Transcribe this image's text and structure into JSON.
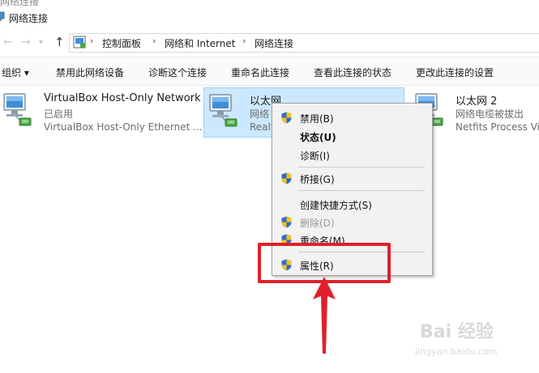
{
  "window": {
    "title": "网络连接",
    "cut_text": "网络连接"
  },
  "nav": {
    "back_icon": "back-arrow-icon",
    "forward_icon": "forward-arrow-icon",
    "up_icon": "up-arrow-icon"
  },
  "breadcrumb": [
    "控制面板",
    "网络和 Internet",
    "网络连接"
  ],
  "toolbar": {
    "organize": "组织 ▾",
    "disable": "禁用此网络设备",
    "diagnose": "诊断这个连接",
    "rename": "重命名此连接",
    "status": "查看此连接的状态",
    "settings": "更改此连接的设置"
  },
  "connections": [
    {
      "name": "VirtualBox Host-Only Network",
      "status": "已启用",
      "device": "VirtualBox Host-Only Ethernet ..."
    },
    {
      "name": "以太网",
      "status": "网络",
      "device": "Realt"
    },
    {
      "name": "以太网 2",
      "status": "网络电缆被拔出",
      "device": "Netfits Process Vi"
    }
  ],
  "context_menu": [
    {
      "label": "禁用(B)",
      "shield": true,
      "bold": false,
      "disabled": false
    },
    {
      "label": "状态(U)",
      "shield": false,
      "bold": true,
      "disabled": false
    },
    {
      "label": "诊断(I)",
      "shield": false,
      "bold": false,
      "disabled": false
    },
    {
      "label": "桥接(G)",
      "shield": true,
      "bold": false,
      "disabled": false
    },
    {
      "label": "创建快捷方式(S)",
      "shield": false,
      "bold": false,
      "disabled": false
    },
    {
      "label": "删除(D)",
      "shield": true,
      "bold": false,
      "disabled": true
    },
    {
      "label": "重命名(M)",
      "shield": true,
      "bold": false,
      "disabled": false
    },
    {
      "label": "属性(R)",
      "shield": true,
      "bold": false,
      "disabled": false
    }
  ],
  "watermark": {
    "brand": "Bai 经验",
    "url": "jingyan.baidu.com"
  },
  "colors": {
    "selection": "#cce8ff",
    "annotation": "#e0202a",
    "menu_bg": "#f2f2f2"
  }
}
